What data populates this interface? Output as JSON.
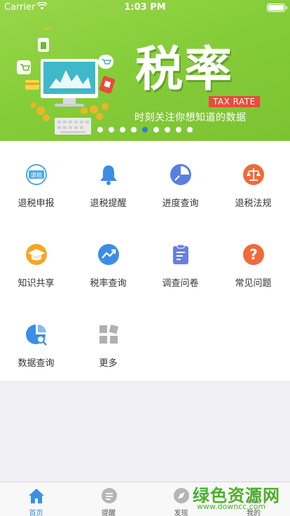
{
  "status": {
    "carrier": "Carrier",
    "time": "1:03 PM"
  },
  "banner": {
    "title": "税率",
    "tag": "TAX RATE",
    "subtitle": "时刻关注你想知道的数据",
    "pages": 9,
    "active_page": 4,
    "accent_color": "#2f7fd0"
  },
  "grid": {
    "items": [
      {
        "label": "退税申报",
        "icon": "tax-refund-icon",
        "icon_text": "退税",
        "color": "#4aa8e8"
      },
      {
        "label": "退税提醒",
        "icon": "bell-icon",
        "color": "#3a8ee6"
      },
      {
        "label": "进度查询",
        "icon": "pie-chart-icon",
        "color": "#5a7fe0"
      },
      {
        "label": "退税法规",
        "icon": "scale-icon",
        "color": "#f06a3a"
      },
      {
        "label": "知识共享",
        "icon": "graduation-cap-icon",
        "color": "#f5a623"
      },
      {
        "label": "税率查询",
        "icon": "trend-chart-icon",
        "color": "#3a8ee6"
      },
      {
        "label": "调查问卷",
        "icon": "clipboard-icon",
        "color": "#6a7fe0"
      },
      {
        "label": "常见问题",
        "icon": "question-icon",
        "color": "#f06a3a"
      },
      {
        "label": "数据查询",
        "icon": "data-search-icon",
        "color": "#3a8ee6"
      },
      {
        "label": "更多",
        "icon": "more-grid-icon",
        "color": "#b0b0b0"
      }
    ]
  },
  "tabbar": {
    "tabs": [
      {
        "label": "首页",
        "icon": "home-icon",
        "active": true
      },
      {
        "label": "提醒",
        "icon": "reminder-icon",
        "active": false
      },
      {
        "label": "发现",
        "icon": "discover-icon",
        "active": false
      },
      {
        "label": "我的",
        "icon": "profile-icon",
        "active": false
      }
    ]
  },
  "watermark": {
    "text": "绿色资源网",
    "url": "www.downcc.com"
  }
}
